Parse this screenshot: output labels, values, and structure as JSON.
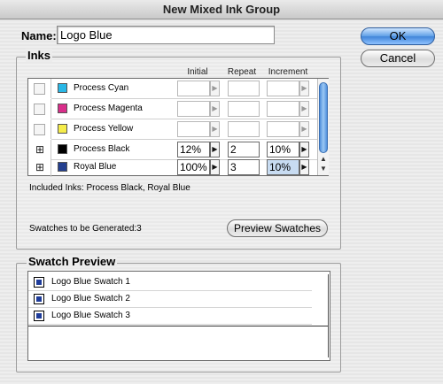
{
  "window": {
    "title": "New Mixed Ink Group"
  },
  "name_field": {
    "label": "Name:",
    "value": "Logo Blue"
  },
  "buttons": {
    "ok": "OK",
    "cancel": "Cancel",
    "preview": "Preview Swatches"
  },
  "inks": {
    "group_label": "Inks",
    "columns": {
      "initial": "Initial",
      "repeat": "Repeat",
      "increment": "Increment"
    },
    "rows": [
      {
        "name": "Process Cyan",
        "color": "#29b7e6",
        "included": false,
        "initial": "",
        "repeat": "",
        "increment": ""
      },
      {
        "name": "Process Magenta",
        "color": "#d92e8a",
        "included": false,
        "initial": "",
        "repeat": "",
        "increment": ""
      },
      {
        "name": "Process Yellow",
        "color": "#f5ec4a",
        "included": false,
        "initial": "",
        "repeat": "",
        "increment": ""
      },
      {
        "name": "Process Black",
        "color": "#000000",
        "included": true,
        "initial": "12%",
        "repeat": "2",
        "increment": "10%"
      },
      {
        "name": "Royal Blue",
        "color": "#233f8f",
        "included": true,
        "initial": "100%",
        "repeat": "3",
        "increment": "10%"
      }
    ],
    "included_text": "Included Inks: Process Black, Royal Blue",
    "swatch_count_text": "Swatches to be Generated:3"
  },
  "swatch_preview": {
    "group_label": "Swatch Preview",
    "color": "#1e3c9a",
    "items": [
      "Logo Blue Swatch 1",
      "Logo Blue Swatch 2",
      "Logo Blue Swatch 3"
    ]
  }
}
